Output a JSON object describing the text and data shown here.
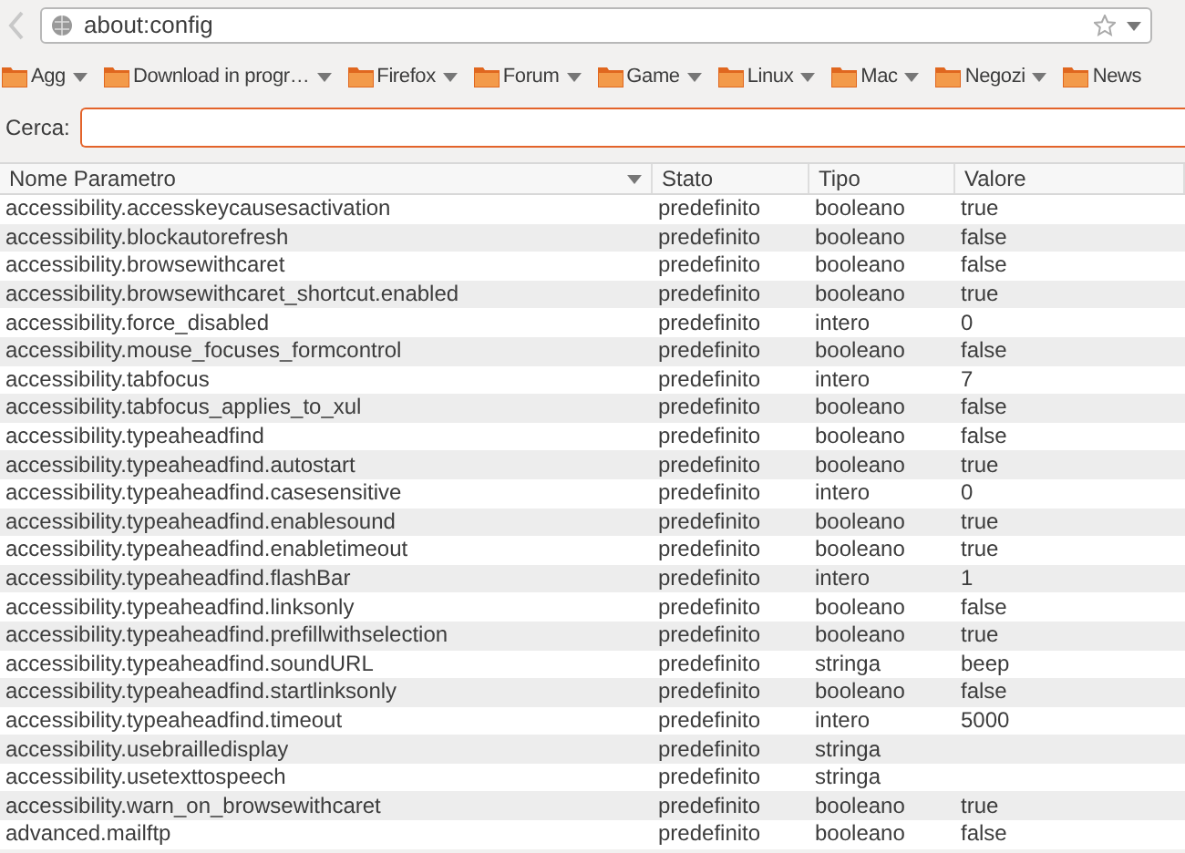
{
  "address_bar": {
    "url": "about:config"
  },
  "bookmarks": [
    {
      "label": "Agg"
    },
    {
      "label": "Download in progr…"
    },
    {
      "label": "Firefox"
    },
    {
      "label": "Forum"
    },
    {
      "label": "Game"
    },
    {
      "label": "Linux"
    },
    {
      "label": "Mac"
    },
    {
      "label": "Negozi"
    },
    {
      "label": "News"
    }
  ],
  "search": {
    "label": "Cerca:"
  },
  "table": {
    "columns": [
      "Nome Parametro",
      "Stato",
      "Tipo",
      "Valore"
    ],
    "rows": [
      [
        "accessibility.accesskeycausesactivation",
        "predefinito",
        "booleano",
        "true"
      ],
      [
        "accessibility.blockautorefresh",
        "predefinito",
        "booleano",
        "false"
      ],
      [
        "accessibility.browsewithcaret",
        "predefinito",
        "booleano",
        "false"
      ],
      [
        "accessibility.browsewithcaret_shortcut.enabled",
        "predefinito",
        "booleano",
        "true"
      ],
      [
        "accessibility.force_disabled",
        "predefinito",
        "intero",
        "0"
      ],
      [
        "accessibility.mouse_focuses_formcontrol",
        "predefinito",
        "booleano",
        "false"
      ],
      [
        "accessibility.tabfocus",
        "predefinito",
        "intero",
        "7"
      ],
      [
        "accessibility.tabfocus_applies_to_xul",
        "predefinito",
        "booleano",
        "false"
      ],
      [
        "accessibility.typeaheadfind",
        "predefinito",
        "booleano",
        "false"
      ],
      [
        "accessibility.typeaheadfind.autostart",
        "predefinito",
        "booleano",
        "true"
      ],
      [
        "accessibility.typeaheadfind.casesensitive",
        "predefinito",
        "intero",
        "0"
      ],
      [
        "accessibility.typeaheadfind.enablesound",
        "predefinito",
        "booleano",
        "true"
      ],
      [
        "accessibility.typeaheadfind.enabletimeout",
        "predefinito",
        "booleano",
        "true"
      ],
      [
        "accessibility.typeaheadfind.flashBar",
        "predefinito",
        "intero",
        "1"
      ],
      [
        "accessibility.typeaheadfind.linksonly",
        "predefinito",
        "booleano",
        "false"
      ],
      [
        "accessibility.typeaheadfind.prefillwithselection",
        "predefinito",
        "booleano",
        "true"
      ],
      [
        "accessibility.typeaheadfind.soundURL",
        "predefinito",
        "stringa",
        "beep"
      ],
      [
        "accessibility.typeaheadfind.startlinksonly",
        "predefinito",
        "booleano",
        "false"
      ],
      [
        "accessibility.typeaheadfind.timeout",
        "predefinito",
        "intero",
        "5000"
      ],
      [
        "accessibility.usebrailledisplay",
        "predefinito",
        "stringa"
      ],
      [
        "accessibility.usetexttospeech",
        "predefinito",
        "stringa"
      ],
      [
        "accessibility.warn_on_browsewithcaret",
        "predefinito",
        "booleano",
        "true"
      ],
      [
        "advanced.mailftp",
        "predefinito",
        "booleano",
        "false"
      ]
    ]
  }
}
